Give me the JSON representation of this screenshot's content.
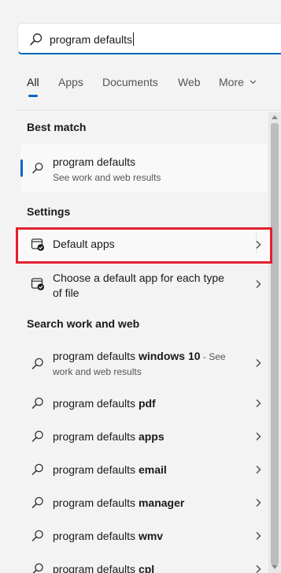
{
  "search": {
    "query": "program defaults",
    "icon": "search-icon"
  },
  "tabs": [
    {
      "label": "All",
      "active": true
    },
    {
      "label": "Apps"
    },
    {
      "label": "Documents"
    },
    {
      "label": "Web"
    },
    {
      "label": "More"
    }
  ],
  "best_match": {
    "heading": "Best match",
    "title": "program defaults",
    "subtitle": "See work and web results"
  },
  "settings": {
    "heading": "Settings",
    "items": [
      {
        "label": "Default apps",
        "highlighted": true
      },
      {
        "label_line1": "Choose a default app for each type",
        "label_line2": "of file"
      }
    ]
  },
  "web": {
    "heading": "Search work and web",
    "items": [
      {
        "prefix": "program defaults ",
        "bold": "windows 10",
        "suffix": " - See",
        "sub": "work and web results"
      },
      {
        "prefix": "program defaults ",
        "bold": "pdf"
      },
      {
        "prefix": "program defaults ",
        "bold": "apps"
      },
      {
        "prefix": "program defaults ",
        "bold": "email"
      },
      {
        "prefix": "program defaults ",
        "bold": "manager"
      },
      {
        "prefix": "program defaults ",
        "bold": "wmv"
      },
      {
        "prefix": "program defaults ",
        "bold": "cpl"
      }
    ]
  },
  "colors": {
    "accent": "#0067c0",
    "highlight": "#e3202f"
  }
}
